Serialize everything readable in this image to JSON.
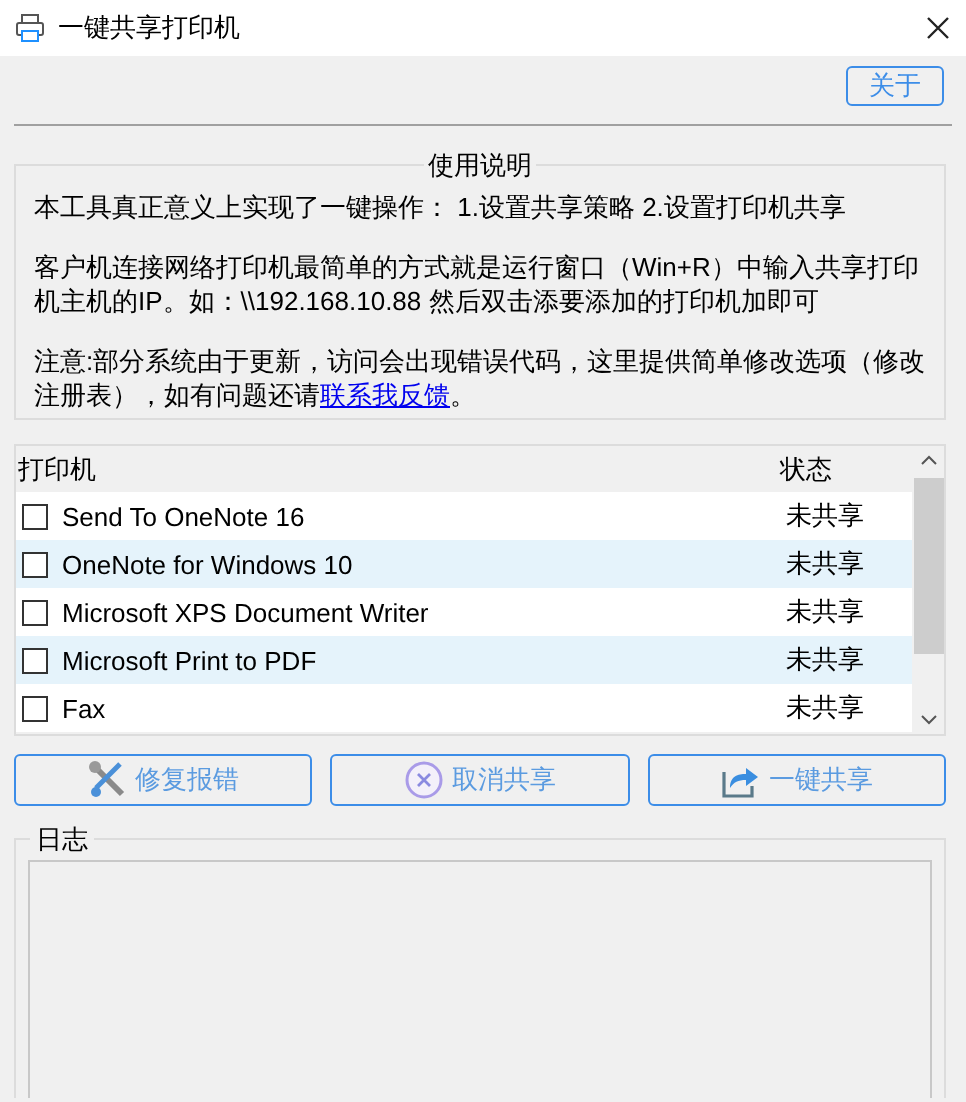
{
  "window": {
    "title": "一键共享打印机"
  },
  "about_button": "关于",
  "instructions": {
    "title": "使用说明",
    "paragraphs": [
      {
        "text": "本工具真正意义上实现了一键操作： 1.设置共享策略 2.设置打印机共享"
      },
      {
        "text": "客户机连接网络打印机最简单的方式就是运行窗口（Win+R）中输入共享打印机主机的IP。如：\\\\192.168.10.88 然后双击添要添加的打印机加即可"
      },
      {
        "text": "注意:部分系统由于更新，访问会出现错误代码，这里提供简单修改选项（修改注册表），如有问题还请",
        "link": "联系我反馈",
        "after": "。"
      }
    ]
  },
  "table": {
    "columns": [
      "打印机",
      "状态"
    ],
    "rows": [
      {
        "name": "Send To OneNote 16",
        "status": "未共享",
        "checked": false
      },
      {
        "name": "OneNote for Windows 10",
        "status": "未共享",
        "checked": false
      },
      {
        "name": "Microsoft XPS Document Writer",
        "status": "未共享",
        "checked": false
      },
      {
        "name": "Microsoft Print to PDF",
        "status": "未共享",
        "checked": false
      },
      {
        "name": "Fax",
        "status": "未共享",
        "checked": false
      }
    ]
  },
  "buttons": [
    {
      "label": "修复报错",
      "kind": "repair"
    },
    {
      "label": "取消共享",
      "kind": "cancel"
    },
    {
      "label": "一键共享",
      "kind": "share"
    }
  ],
  "log": {
    "title": "日志"
  }
}
